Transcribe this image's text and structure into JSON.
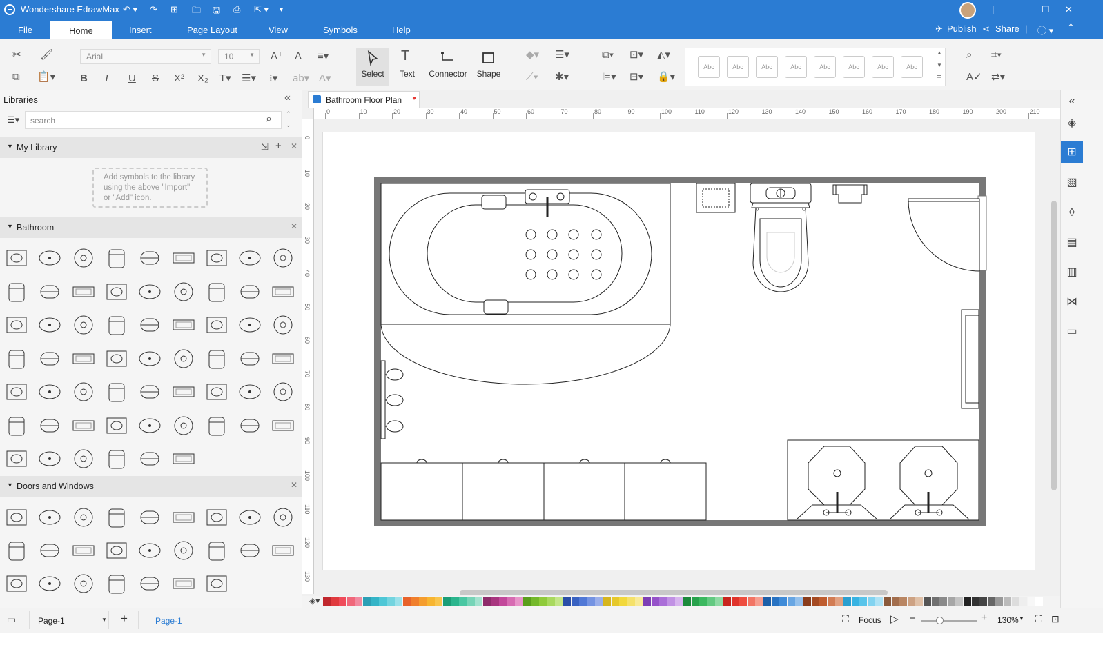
{
  "app": {
    "title": "Wondershare EdrawMax"
  },
  "menu": {
    "items": [
      "File",
      "Home",
      "Insert",
      "Page Layout",
      "View",
      "Symbols",
      "Help"
    ],
    "active": "Home",
    "publish": "Publish",
    "share": "Share"
  },
  "ribbon": {
    "font_name": "Arial",
    "font_size": "10",
    "tools": [
      "Select",
      "Text",
      "Connector",
      "Shape"
    ],
    "style_preview_label": "Abc"
  },
  "libraries": {
    "title": "Libraries",
    "search_placeholder": "search",
    "my_library": {
      "title": "My Library",
      "hint": [
        "Add symbols to the library",
        "using the above \"Import\"",
        "or \"Add\" icon."
      ]
    },
    "bathroom": {
      "title": "Bathroom"
    },
    "doors_windows": {
      "title": "Doors and Windows"
    }
  },
  "document": {
    "tab_title": "Bathroom Floor Plan",
    "ruler_h": [
      "0",
      "10",
      "20",
      "30",
      "40",
      "50",
      "60",
      "70",
      "80",
      "90",
      "100",
      "110",
      "120",
      "130",
      "140",
      "150",
      "160",
      "170",
      "180",
      "190",
      "200",
      "210"
    ],
    "ruler_v": [
      "0",
      "10",
      "20",
      "30",
      "40",
      "50",
      "60",
      "70",
      "80",
      "90",
      "100",
      "110",
      "120",
      "130"
    ]
  },
  "status": {
    "page_select": "Page-1",
    "page_tab": "Page-1",
    "focus": "Focus",
    "zoom": "130%"
  },
  "palette": [
    "#c0272d",
    "#e03a3e",
    "#ef4b5a",
    "#f0677a",
    "#f28aa0",
    "#2c9fb5",
    "#34b4c7",
    "#4ec7d6",
    "#73d4df",
    "#9be1ea",
    "#e8632b",
    "#f07f2c",
    "#f59d2e",
    "#f7b531",
    "#f9c54d",
    "#1b9e77",
    "#2bb58d",
    "#49c7a2",
    "#76d4b7",
    "#a3e2cf",
    "#8e2c6b",
    "#a8357f",
    "#c2479a",
    "#d76bb2",
    "#e894c9",
    "#5a9e1b",
    "#74b82a",
    "#8fcb3a",
    "#a9d95e",
    "#c4e688",
    "#2b4fa8",
    "#3962c2",
    "#5078d6",
    "#7493e2",
    "#9aaeea",
    "#d6b51e",
    "#e6c82a",
    "#f2d83b",
    "#f5e16a",
    "#f8ea98",
    "#7d3fb5",
    "#9552c9",
    "#aa6ed8",
    "#c191e4",
    "#d7b4ee",
    "#1c8a3c",
    "#28a24c",
    "#3bb85f",
    "#63c981",
    "#8fdaa4",
    "#c8251e",
    "#e0332b",
    "#ee4d3f",
    "#f27565",
    "#f69e90",
    "#1c5fa8",
    "#2873c3",
    "#3f8bd8",
    "#68a6e3",
    "#95c1ec",
    "#8a3d1c",
    "#a54a22",
    "#bf5d2f",
    "#d27c53",
    "#e2a181",
    "#2a9fd0",
    "#38b3e2",
    "#58c4ea",
    "#82d3f0",
    "#aee2f5",
    "#8a5a3c",
    "#a36e4d",
    "#b98663",
    "#cda283",
    "#e0c1a8",
    "#555555",
    "#707070",
    "#8a8a8a",
    "#a6a6a6",
    "#c4c4c4",
    "#222222",
    "#333333",
    "#444444",
    "#666666",
    "#999999",
    "#bbbbbb",
    "#dddddd",
    "#eeeeee",
    "#f7f7f7",
    "#ffffff"
  ]
}
